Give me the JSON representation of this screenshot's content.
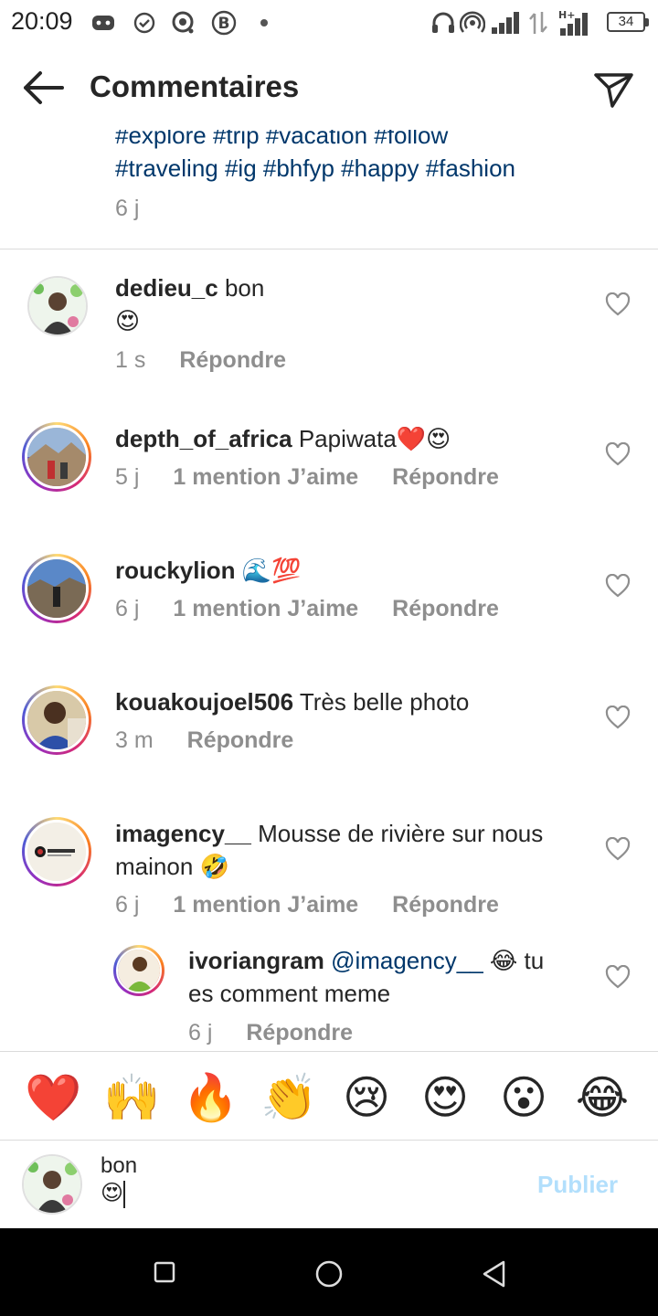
{
  "status_bar": {
    "time": "20:09",
    "battery": "34",
    "network_label": "H+"
  },
  "header": {
    "title": "Commentaires"
  },
  "caption": {
    "hashtags_line1": "#explore #trip #vacation #follow",
    "hashtags_line2": "#traveling #ig #bhfyp #happy #fashion",
    "time": "6 j"
  },
  "comments": [
    {
      "username": "dedieu_c",
      "text": "bon",
      "emoji": "😍",
      "time": "1 s",
      "likes": "",
      "reply": "Répondre"
    },
    {
      "username": "depth_of_africa",
      "text": "Papiwata❤️😍",
      "time": "5 j",
      "likes": "1 mention J’aime",
      "reply": "Répondre"
    },
    {
      "username": "rouckylion",
      "text": "🌊💯",
      "time": "6 j",
      "likes": "1 mention J’aime",
      "reply": "Répondre"
    },
    {
      "username": "kouakoujoel506",
      "text": "Très belle photo",
      "time": "3 m",
      "likes": "",
      "reply": "Répondre"
    },
    {
      "username": "imagency__",
      "text": "Mousse de rivière sur nous mainon 🤣",
      "time": "6 j",
      "likes": "1 mention J’aime",
      "reply": "Répondre"
    },
    {
      "username": "ivoriangram",
      "mention": "@imagency__",
      "text": "😂 tu es comment meme",
      "time": "6 j",
      "likes": "",
      "reply": "Répondre"
    }
  ],
  "emoji_bar": [
    "❤️",
    "🙌",
    "🔥",
    "👏",
    "😢",
    "😍",
    "😮",
    "😂"
  ],
  "input": {
    "value_line1": "bon",
    "value_line2": "😍",
    "publish_label": "Publier"
  },
  "colors": {
    "link": "#00376b",
    "muted": "#8e8e8e",
    "publish_disabled": "#b2dffc"
  }
}
